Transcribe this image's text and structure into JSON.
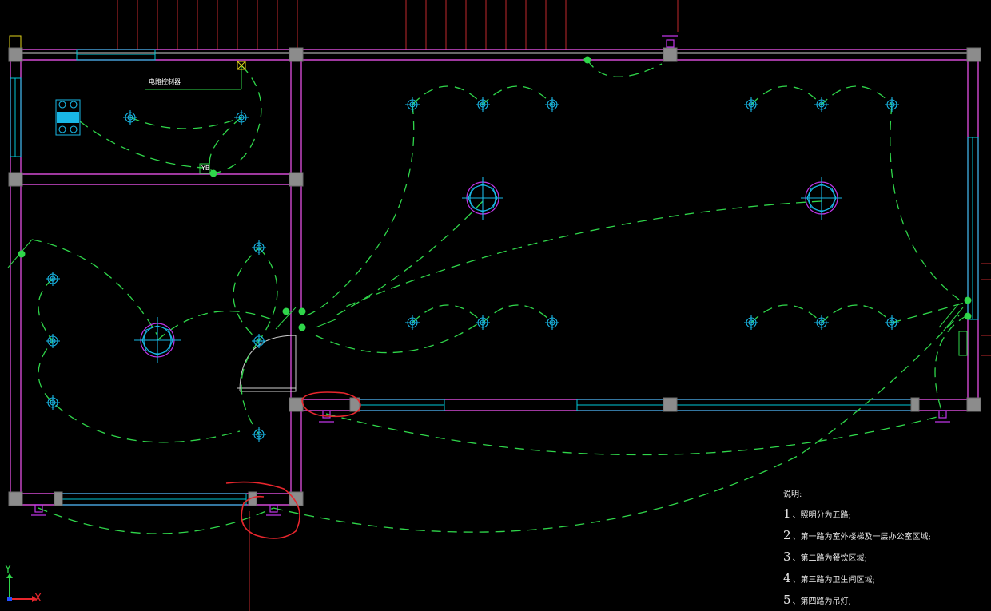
{
  "drawing": {
    "label_top_left": "电路控制器",
    "switch_tag": "YB",
    "notes": {
      "title": "说明:",
      "items": [
        {
          "num": "1",
          "text": "、照明分为五路;"
        },
        {
          "num": "2",
          "text": "、第一路为室外楼梯及一层办公室区域;"
        },
        {
          "num": "3",
          "text": "、第二路为餐饮区域;"
        },
        {
          "num": "4",
          "text": "、第三路为卫生间区域;"
        },
        {
          "num": "5",
          "text": "、第四路为吊灯;"
        }
      ]
    },
    "ucs": {
      "x_label": "X",
      "y_label": "Y"
    }
  },
  "colors": {
    "wall": "#d24bd2",
    "window": "#00c8d8",
    "wire": "#2fd64a",
    "lamp": "#19b7e6",
    "markup": "#e8262d",
    "background": "#000000"
  }
}
